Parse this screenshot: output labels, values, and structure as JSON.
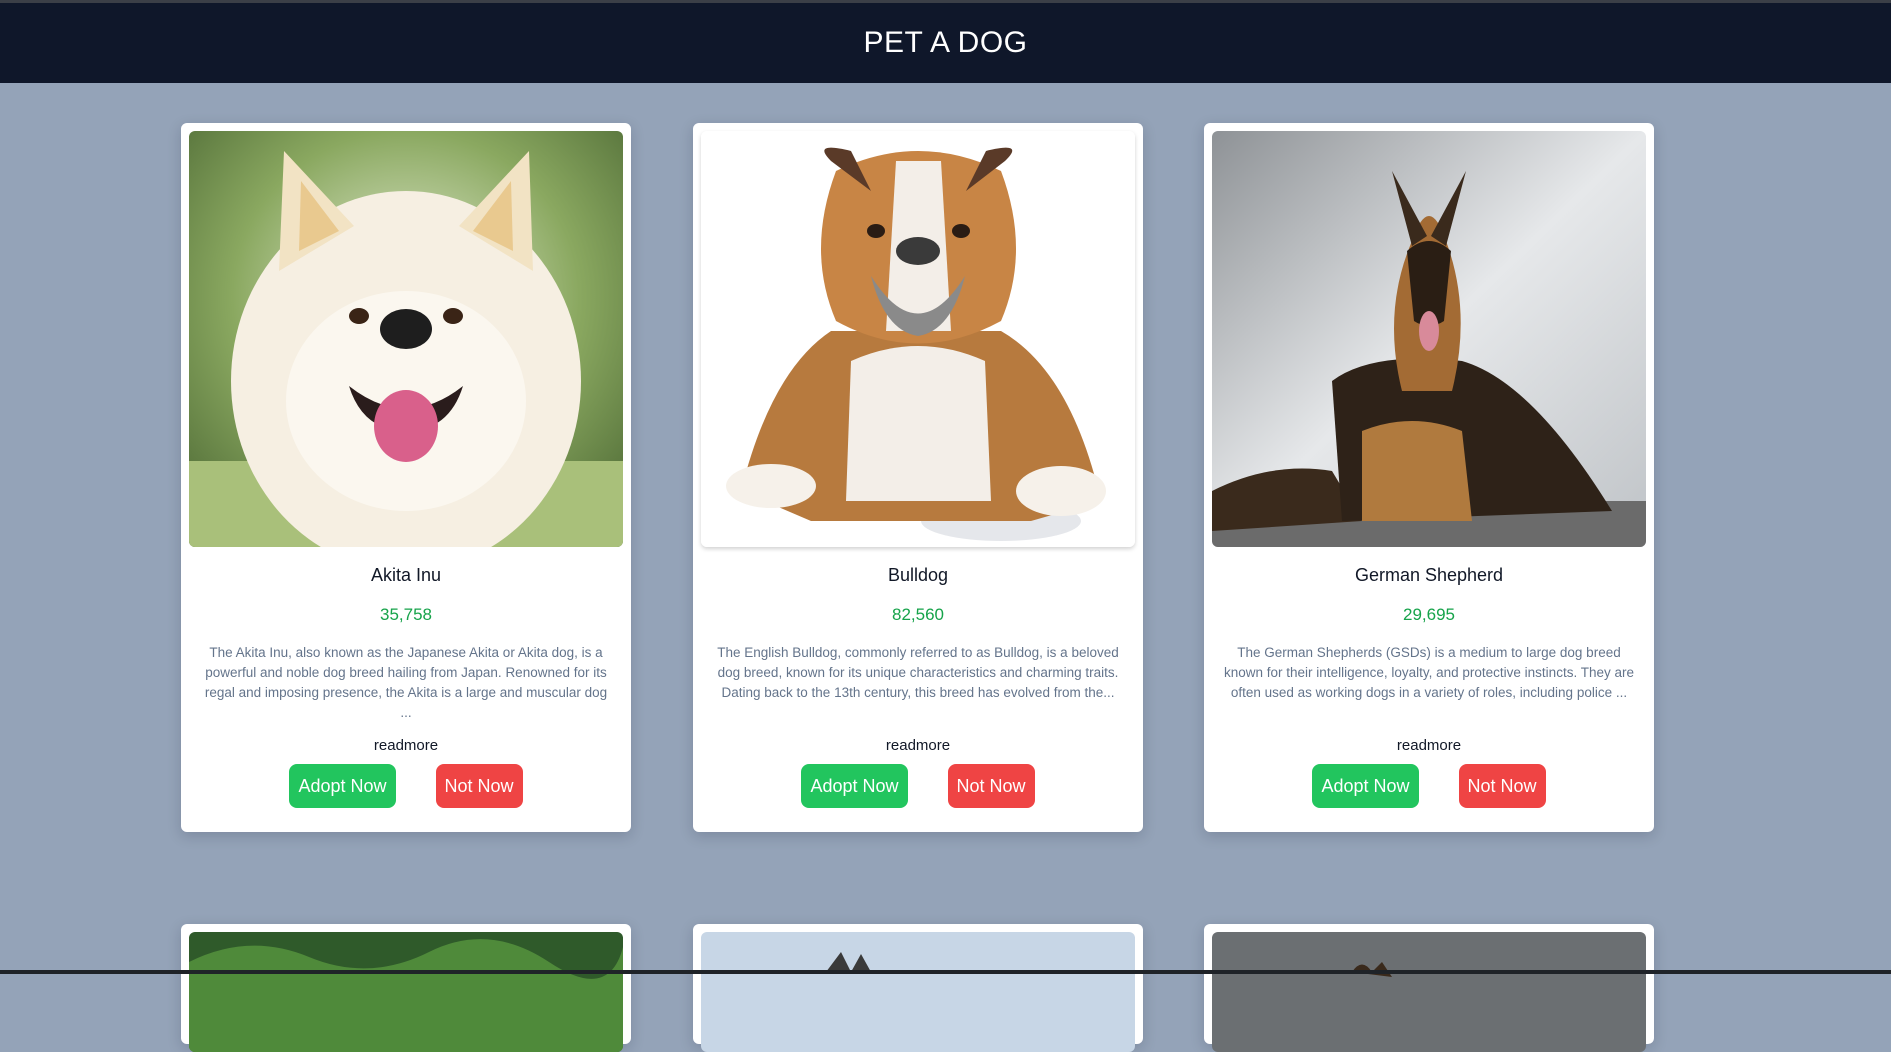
{
  "header": {
    "title": "PET A DOG"
  },
  "cards": [
    {
      "image_icon": "akita-inu-photo",
      "name": "Akita Inu",
      "price": "35,758",
      "description": "The Akita Inu, also known as the Japanese Akita or Akita dog, is a powerful and noble dog breed hailing from Japan. Renowned for its regal and imposing presence, the Akita is a large and muscular dog ...",
      "readmore_label": "readmore",
      "adopt_label": "Adopt Now",
      "reject_label": "Not Now"
    },
    {
      "image_icon": "bulldog-photo",
      "name": "Bulldog",
      "price": "82,560",
      "description": "The English Bulldog, commonly referred to as Bulldog, is a beloved dog breed, known for its unique characteristics and charming traits. Dating back to the 13th century, this breed has evolved from the...",
      "readmore_label": "readmore",
      "adopt_label": "Adopt Now",
      "reject_label": "Not Now"
    },
    {
      "image_icon": "german-shepherd-photo",
      "name": "German Shepherd",
      "price": "29,695",
      "description": "The German Shepherds (GSDs) is a medium to large dog breed known for their intelligence, loyalty, and protective instincts. They are often used as working dogs in a variety of roles, including police ...",
      "readmore_label": "readmore",
      "adopt_label": "Adopt Now",
      "reject_label": "Not Now"
    }
  ],
  "colors": {
    "header_bg": "#0f172a",
    "page_bg": "#94a3b8",
    "price": "#16a34a",
    "adopt_button": "#22c55e",
    "reject_button": "#ef4444"
  }
}
